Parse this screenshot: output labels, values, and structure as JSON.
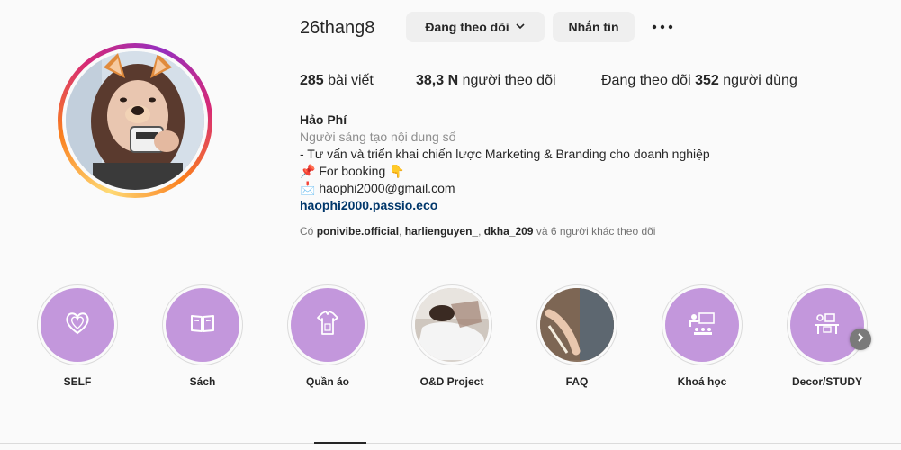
{
  "profile": {
    "username": "26thang8",
    "follow_button": "Đang theo dõi",
    "message_button": "Nhắn tin",
    "more_icon": "more-horizontal-icon"
  },
  "stats": {
    "posts_count": "285",
    "posts_label": "bài viết",
    "followers_count": "38,3 N",
    "followers_label": "người theo dõi",
    "following_prefix": "Đang theo dõi",
    "following_count": "352",
    "following_label": "người dùng"
  },
  "bio": {
    "name": "Hảo Phí",
    "category": "Người sáng tạo nội dung số",
    "line1": "- Tư vấn và triển khai chiến lược Marketing & Branding cho doanh nghiệp",
    "line2_emoji": "📌",
    "line2": "For booking",
    "line2_emoji_after": "👇",
    "line3_emoji": "📩",
    "line3": "haophi2000@gmail.com",
    "link": "haophi2000.passio.eco"
  },
  "followed_by": {
    "prefix": "Có",
    "user1": "ponivibe.official",
    "sep1": ",",
    "user2": "harlienguyen_",
    "sep2": ",",
    "user3": "dkha_209",
    "suffix": "và 6 người khác theo dõi"
  },
  "highlights": [
    {
      "label": "SELF",
      "icon": "heart-icon"
    },
    {
      "label": "Sách",
      "icon": "book-icon"
    },
    {
      "label": "Quần áo",
      "icon": "clothes-icon"
    },
    {
      "label": "O&D Project",
      "icon": "photo"
    },
    {
      "label": "FAQ",
      "icon": "photo"
    },
    {
      "label": "Khoá học",
      "icon": "teacher-icon"
    },
    {
      "label": "Decor/STUDY",
      "icon": "desk-icon"
    }
  ],
  "colors": {
    "highlight_bg": "#c397dc",
    "link": "#00376b",
    "secondary_text": "#8e8e8e"
  }
}
